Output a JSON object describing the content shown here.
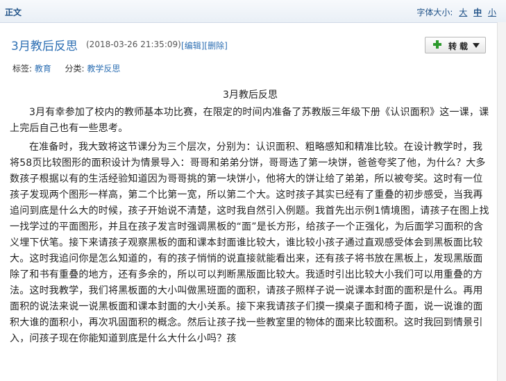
{
  "header": {
    "section_label": "正文",
    "font_size_label": "字体大小:",
    "font_sizes": [
      "大",
      "中",
      "小"
    ]
  },
  "post": {
    "title": "3月教后反思",
    "date": "(2018-03-26 21:35:09)",
    "edit_links": {
      "open": "[",
      "edit": "编辑",
      "sep": "][",
      "delete": "删除",
      "close": "]"
    },
    "repost_label": "转载",
    "tags_label": "标签:",
    "tag": "教育",
    "category_label": "分类:",
    "category": "教学反思"
  },
  "article": {
    "title": "3月教后反思",
    "paragraphs": [
      "3月有幸参加了校内的教师基本功比赛，在限定的时间内准备了苏教版三年级下册《认识面积》这一课，课上完后自己也有一些思考。",
      "在准备时，我大致将这节课分为三个层次，分别为：认识面积、粗略感知和精准比较。在设计教学时，我将58页比较图形的面积设计为情景导入：哥哥和弟弟分饼，哥哥选了第一块饼，爸爸夸奖了他，为什么？大多数孩子根据以有的生活经验知道因为哥哥挑的第一块饼小，他将大的饼让给了弟弟，所以被夸奖。这时有一位孩子发现两个图形一样高，第二个比第一宽，所以第二个大。这时孩子其实已经有了重叠的初步感受，当我再追问到底是什么大的时候，孩子开始说不清楚，这时我自然引入例题。我首先出示例1情境图，请孩子在图上找一找学过的平面图形，并且在孩子发言时强调黑板的“面”是长方形，给孩子一个正强化，为后面学习面积的含义埋下伏笔。接下来请孩子观察黑板的面和课本封面谁比较大，谁比较小孩子通过直观感受体会到黑板面比较大。这时我追问你是怎么知道的，有的孩子悄悄的说直接就能看出来，还有孩子将书放在黑板上，发现黑版面除了和书有重叠的地方，还有多余的，所以可以判断黑版面比较大。我适时引出比较大小我们可以用重叠的方法。这时我教学，我们将黑板面的大小叫做黑班面的面积，请孩子照样子说一说课本封面的面积是什么。再用面积的说法来说一说黑板面和课本封面的大小关系。接下来我请孩子们摸一摸桌子面和椅子面，说一说谁的面积大谁的面积小，再次巩固面积的概念。然后让孩子找一些教室里的物体的面来比较面积。这时我回到情景引入，问孩子现在你能知道到底是什么大什么小吗？孩"
    ]
  },
  "colors": {
    "link": "#2d6fb3",
    "header_text": "#1c4f86",
    "repost_plus": "#2c9a2c"
  },
  "icons": {
    "repost": "plus-icon",
    "dropdown": "triangle-down-icon"
  }
}
